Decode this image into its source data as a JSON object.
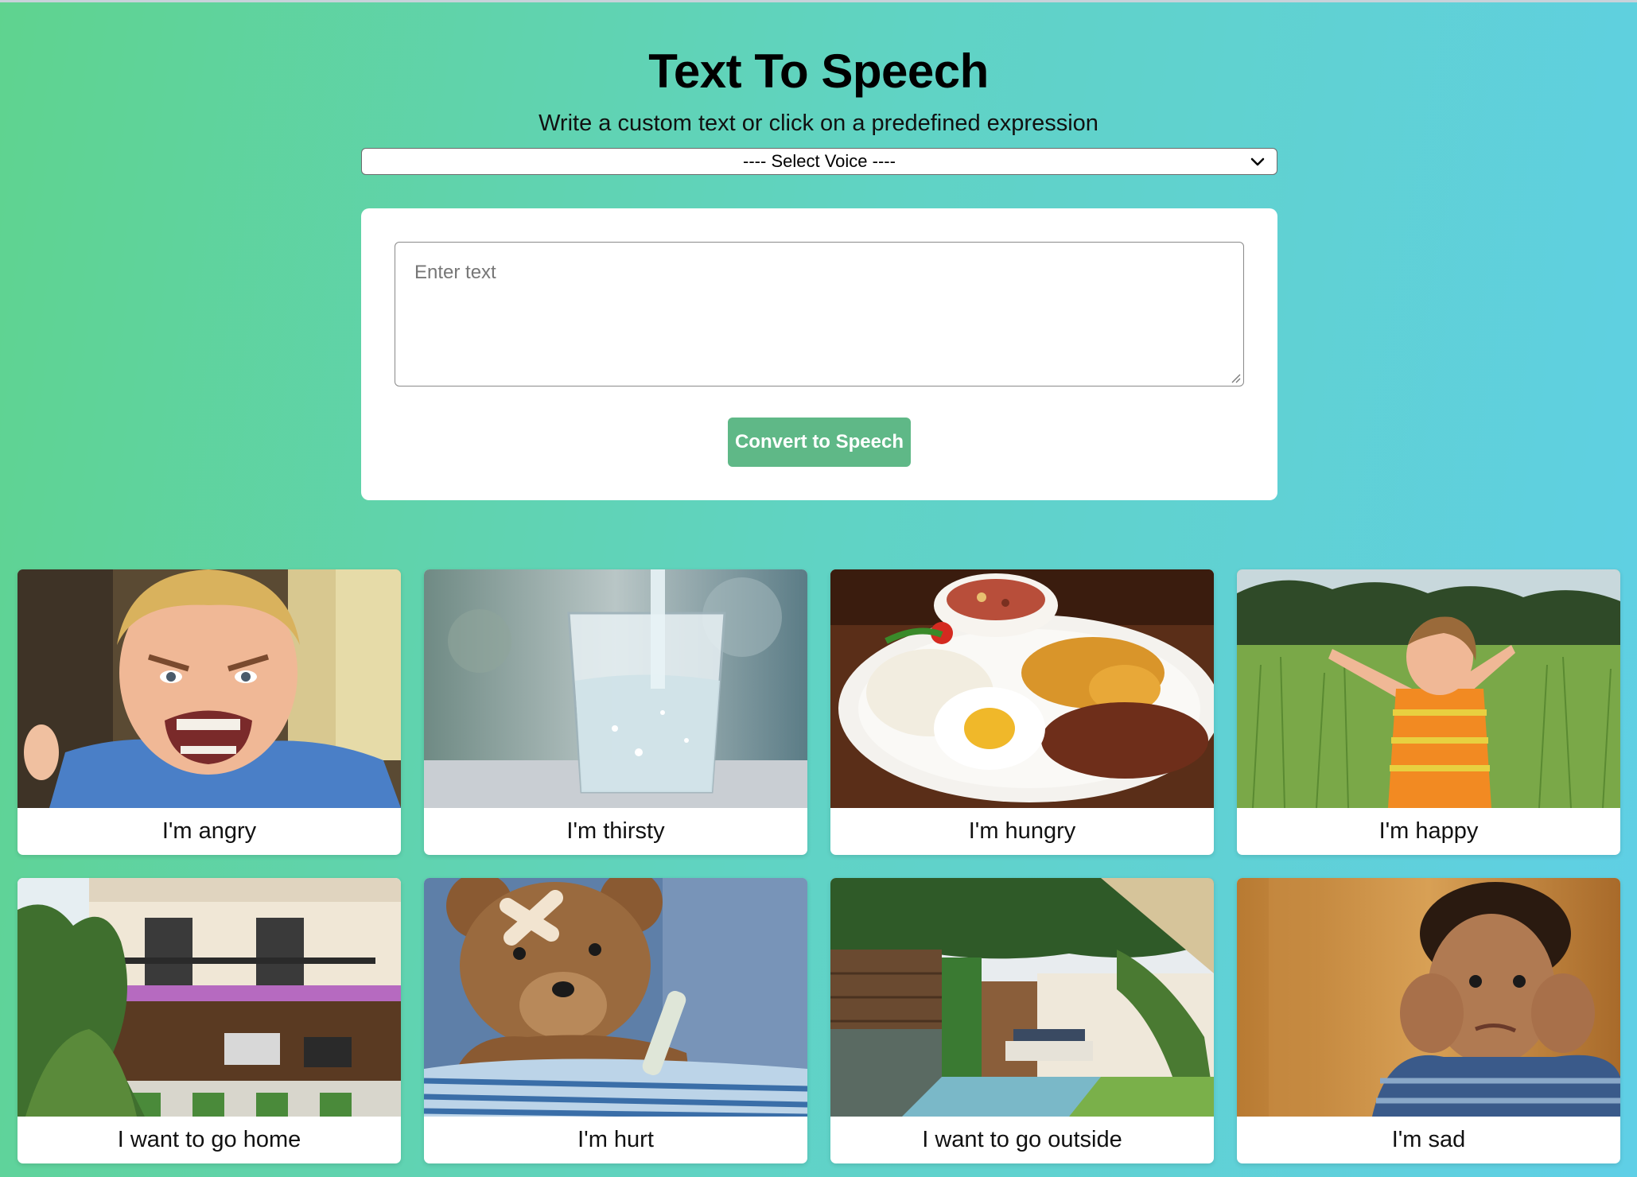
{
  "header": {
    "title": "Text To Speech",
    "subtitle": "Write a custom text or click on a predefined expression"
  },
  "voice_select": {
    "selected": "---- Select Voice ----",
    "icon": "chevron-down-icon"
  },
  "input": {
    "value": "",
    "placeholder": "Enter text"
  },
  "convert_button": {
    "label": "Convert to Speech",
    "color": "#5fb887"
  },
  "expressions": [
    {
      "label": "I'm angry",
      "image": "angry-child-photo"
    },
    {
      "label": "I'm thirsty",
      "image": "glass-of-water-photo"
    },
    {
      "label": "I'm hungry",
      "image": "plate-of-food-photo"
    },
    {
      "label": "I'm happy",
      "image": "happy-child-in-field-photo"
    },
    {
      "label": "I want to go home",
      "image": "house-photo"
    },
    {
      "label": "I'm hurt",
      "image": "bandaged-teddy-bear-photo"
    },
    {
      "label": "I want to go outside",
      "image": "garden-patio-photo"
    },
    {
      "label": "I'm sad",
      "image": "sad-child-photo"
    }
  ],
  "colors": {
    "background_start": "#5fd38f",
    "background_end": "#5fcfe6",
    "panel": "#ffffff"
  }
}
